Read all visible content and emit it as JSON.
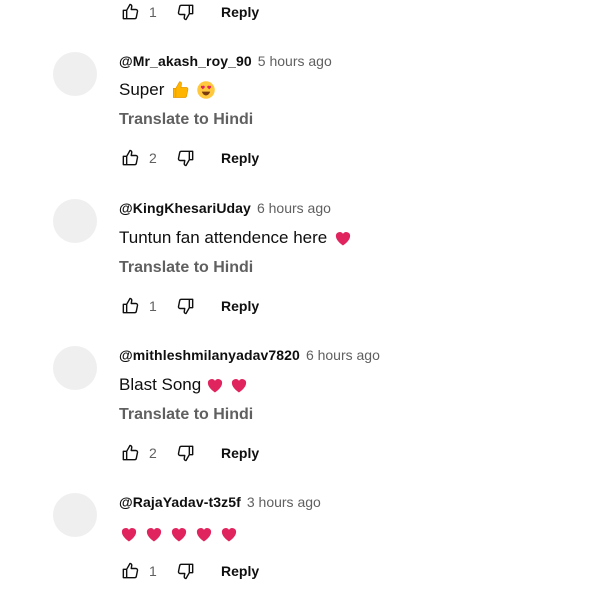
{
  "top_actions": {
    "like_count": "1",
    "reply_label": "Reply"
  },
  "comments": [
    {
      "author": "@Mr_akash_roy_90",
      "time": "5 hours ago",
      "text": "Super",
      "emojis": [
        "thumbs-up",
        "heart-eyes"
      ],
      "translate_label": "Translate to Hindi",
      "like_count": "2",
      "reply_label": "Reply"
    },
    {
      "author": "@KingKhesariUday",
      "time": "6 hours ago",
      "text": "Tuntun fan attendence here",
      "emojis": [
        "red-heart"
      ],
      "translate_label": "Translate to Hindi",
      "like_count": "1",
      "reply_label": "Reply"
    },
    {
      "author": "@mithleshmilanyadav7820",
      "time": "6 hours ago",
      "text": "Blast Song",
      "emojis": [
        "red-heart",
        "red-heart"
      ],
      "translate_label": "Translate to Hindi",
      "like_count": "2",
      "reply_label": "Reply"
    },
    {
      "author": "@RajaYadav-t3z5f",
      "time": "3 hours ago",
      "text": "",
      "emojis": [
        "red-heart",
        "red-heart",
        "red-heart",
        "red-heart",
        "red-heart"
      ],
      "like_count": "1",
      "reply_label": "Reply"
    }
  ],
  "colors": {
    "heart": "#e0245e",
    "thumb": "#ffb400",
    "avatar": "#efefef",
    "muted": "#606060"
  }
}
